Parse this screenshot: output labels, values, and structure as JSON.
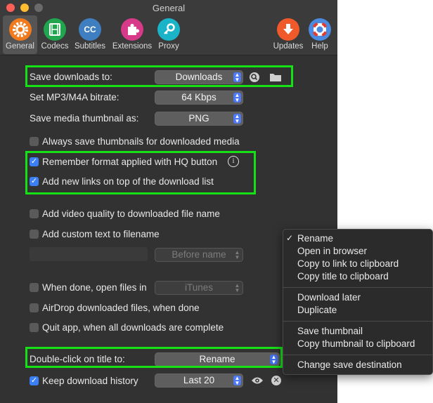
{
  "window": {
    "title": "General"
  },
  "toolbar": {
    "items": [
      {
        "label": "General",
        "icon": "gear-icon",
        "color": "#f07a1c"
      },
      {
        "label": "Codecs",
        "icon": "film-icon",
        "color": "#21a54e"
      },
      {
        "label": "Subtitles",
        "icon": "cc-icon",
        "color": "#3f7fc1"
      },
      {
        "label": "Extensions",
        "icon": "puzzle-icon",
        "color": "#d63a88"
      },
      {
        "label": "Proxy",
        "icon": "key-icon",
        "color": "#1ab3c7"
      },
      {
        "label": "Updates",
        "icon": "download-arrow-icon",
        "color": "#f05a2a"
      },
      {
        "label": "Help",
        "icon": "lifebuoy-icon",
        "color": "#4a8ae0"
      }
    ],
    "cc_text": "CC"
  },
  "settings": {
    "save_downloads_label": "Save downloads to:",
    "save_downloads_value": "Downloads",
    "bitrate_label": "Set MP3/M4A bitrate:",
    "bitrate_value": "64 Kbps",
    "thumbnail_label": "Save media thumbnail as:",
    "thumbnail_value": "PNG",
    "always_save_thumbs": "Always save thumbnails for downloaded media",
    "remember_format": "Remember format applied with HQ button",
    "add_links_top": "Add new links on top of the download list",
    "add_quality": "Add video quality to downloaded file name",
    "add_custom_text": "Add custom text to filename",
    "before_name": "Before name",
    "when_done_label": "When done, open files in",
    "when_done_value": "iTunes",
    "airdrop": "AirDrop downloaded files, when done",
    "quit_app": "Quit app, when all downloads are complete",
    "double_click_label": "Double-click on title to:",
    "double_click_value": "Rename",
    "keep_history": "Keep download history",
    "history_value": "Last 20"
  },
  "context_menu": {
    "group1": [
      "Rename",
      "Open in browser",
      "Copy to link to clipboard",
      "Copy title to clipboard"
    ],
    "group2": [
      "Download later",
      "Duplicate"
    ],
    "group3": [
      "Save thumbnail",
      "Copy thumbnail to clipboard"
    ],
    "group4": [
      "Change save destination"
    ],
    "checkmark": "✓"
  },
  "colors": {
    "highlight": "#16e016",
    "accent": "#3b7ff5"
  }
}
